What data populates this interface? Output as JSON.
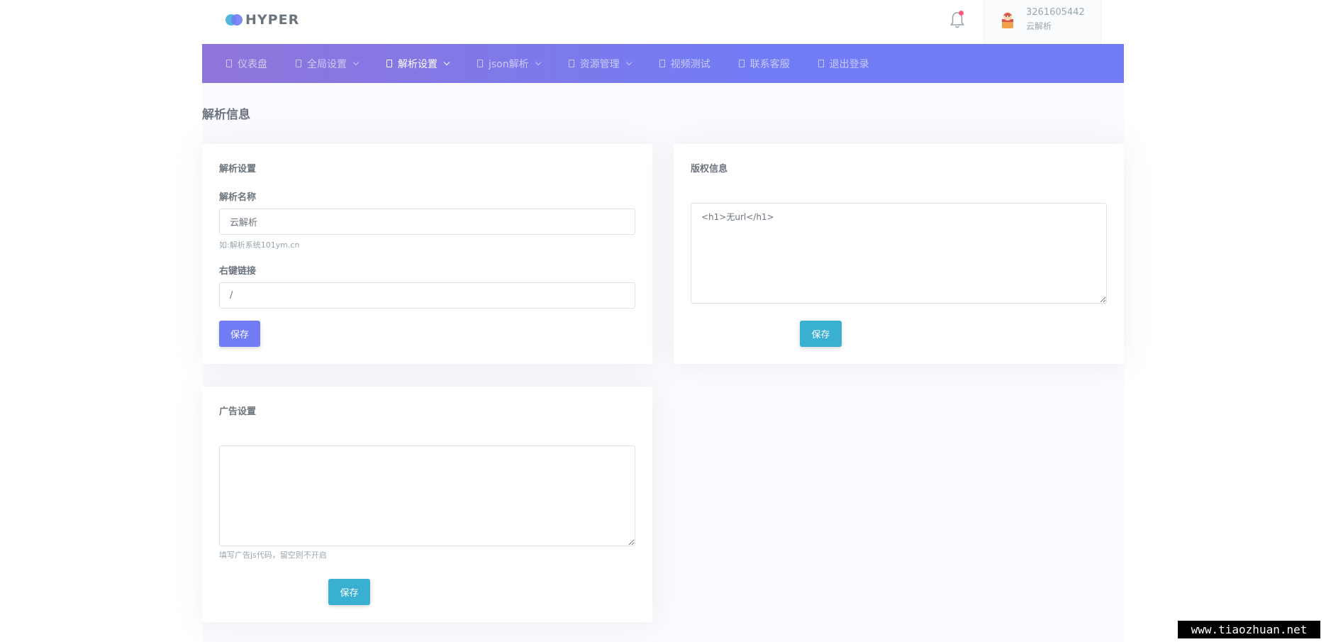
{
  "brand": {
    "name": "HYPER"
  },
  "user": {
    "id": "3261605442",
    "name": "云解析"
  },
  "nav": {
    "items": [
      {
        "label": "仪表盘",
        "dropdown": false
      },
      {
        "label": "全局设置",
        "dropdown": true
      },
      {
        "label": "解析设置",
        "dropdown": true,
        "active": true
      },
      {
        "label": "json解析",
        "dropdown": true
      },
      {
        "label": "资源管理",
        "dropdown": true
      },
      {
        "label": "视频测试",
        "dropdown": false
      },
      {
        "label": "联系客服",
        "dropdown": false
      },
      {
        "label": "退出登录",
        "dropdown": false
      }
    ]
  },
  "page": {
    "title": "解析信息"
  },
  "parse_settings": {
    "title": "解析设置",
    "name_label": "解析名称",
    "name_value": "云解析",
    "name_help": "如:解析系统101ym.cn",
    "link_label": "右键链接",
    "link_value": "/",
    "save_label": "保存"
  },
  "copyright": {
    "title": "版权信息",
    "content": "<h1>无url</h1>",
    "save_label": "保存"
  },
  "ads": {
    "title": "广告设置",
    "content": "",
    "help": "填写广告js代码，留空则不开启",
    "save_label": "保存"
  },
  "watermark": {
    "text": "www.tiaozhuan.net"
  },
  "colors": {
    "primary": "#727cf5",
    "info": "#39afd1",
    "nav_start": "#8f75da",
    "nav_end": "#727cf5",
    "bell_dot": "#fa5c7c"
  }
}
